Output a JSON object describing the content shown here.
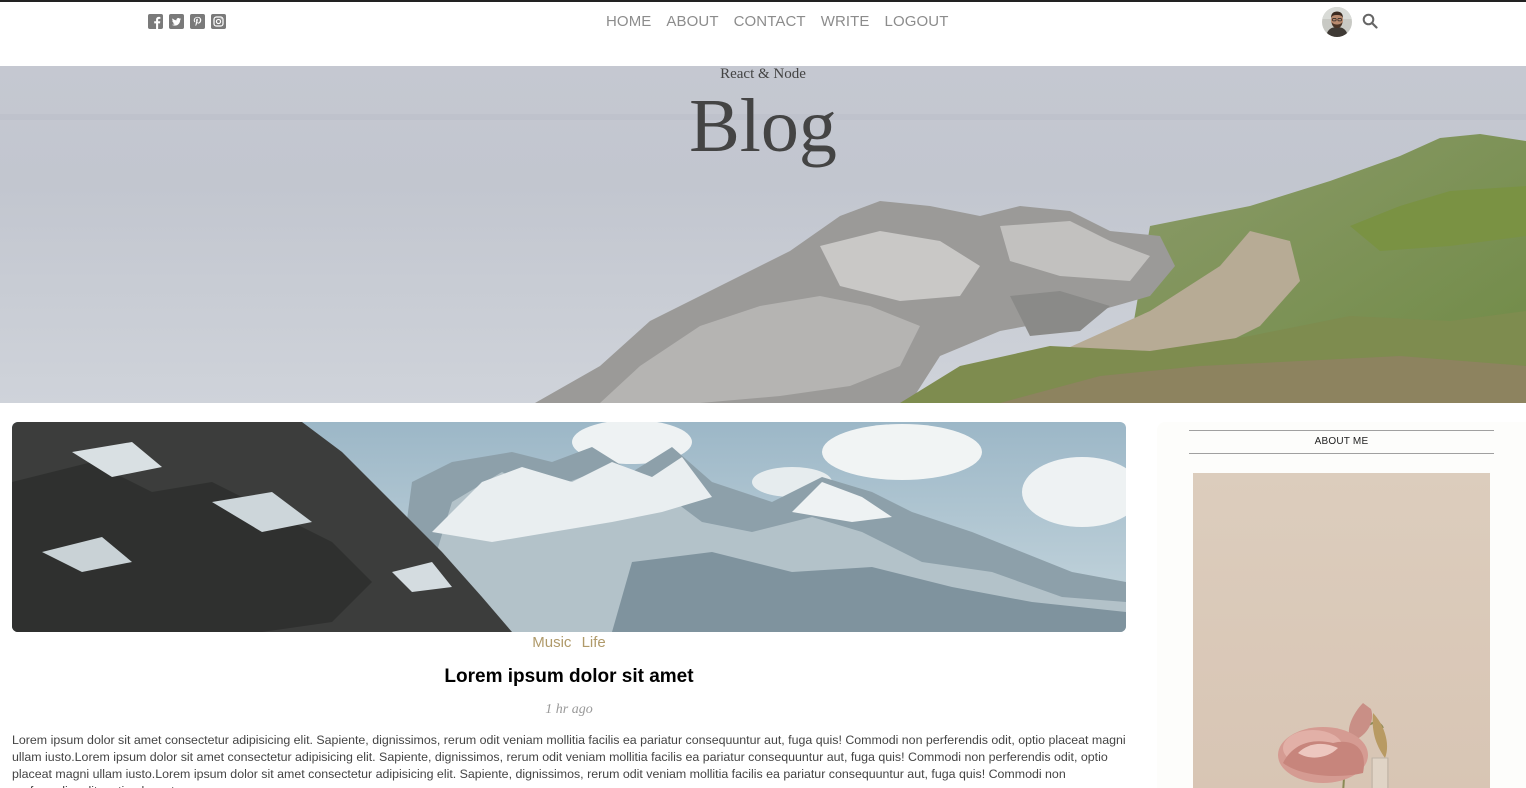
{
  "topbar": {
    "social_icons": [
      "facebook-square-icon",
      "twitter-square-icon",
      "pinterest-square-icon",
      "instagram-square-icon"
    ],
    "nav": [
      "HOME",
      "ABOUT",
      "CONTACT",
      "WRITE",
      "LOGOUT"
    ],
    "search_icon": "search-icon"
  },
  "header": {
    "subtitle": "React & Node",
    "title": "Blog"
  },
  "post": {
    "categories": [
      "Music",
      "Life"
    ],
    "title": "Lorem ipsum dolor sit amet",
    "date": "1 hr ago",
    "description": "Lorem ipsum dolor sit amet consectetur adipisicing elit. Sapiente, dignissimos, rerum odit veniam mollitia facilis ea pariatur consequuntur aut, fuga quis! Commodi non perferendis odit, optio placeat magni ullam iusto.Lorem ipsum dolor sit amet consectetur adipisicing elit. Sapiente, dignissimos, rerum odit veniam mollitia facilis ea pariatur consequuntur aut, fuga quis! Commodi non perferendis odit, optio placeat magni ullam iusto.Lorem ipsum dolor sit amet consectetur adipisicing elit. Sapiente, dignissimos, rerum odit veniam mollitia facilis ea pariatur consequuntur aut, fuga quis! Commodi non perferendis odit, optio placeat"
  },
  "sidebar": {
    "title": "ABOUT ME"
  },
  "colors": {
    "nav_text": "#8c8c8c",
    "category": "#b09a6a",
    "title_text": "#444444"
  }
}
